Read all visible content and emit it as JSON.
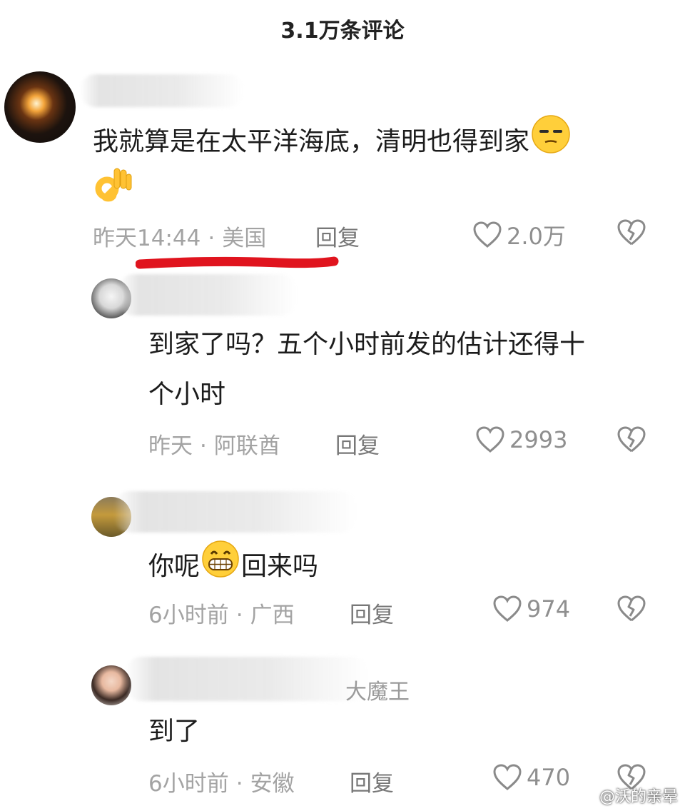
{
  "header": {
    "title": "3.1万条评论"
  },
  "comments": [
    {
      "text_line1": "我就算是在太平洋海底，清明也得到家",
      "time": "昨天14:44",
      "location": "美国",
      "reply_label": "回复",
      "likes": "2.0万"
    },
    {
      "text_line1": "到家了吗？五个小时前发的估计还得十",
      "text_line2": "个小时",
      "time": "昨天",
      "location": "阿联酋",
      "reply_label": "回复",
      "likes": "2993"
    },
    {
      "text_a": "你呢",
      "text_b": "回来吗",
      "time": "6小时前",
      "location": "广西",
      "reply_label": "回复",
      "likes": "974"
    },
    {
      "name_visible_tail": "大魔王",
      "text_line1": "到了",
      "time": "6小时前",
      "location": "安徽",
      "reply_label": "回复",
      "likes": "470"
    }
  ],
  "separator": "·",
  "watermark": {
    "text": "@沃的亲晕"
  },
  "colors": {
    "meta": "#a3a3a3",
    "annotation": "#e0141e"
  }
}
